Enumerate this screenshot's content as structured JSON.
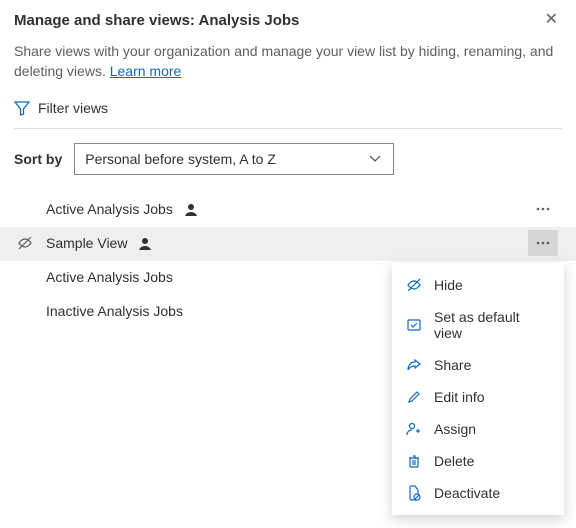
{
  "header": {
    "title": "Manage and share views: Analysis Jobs"
  },
  "description": {
    "text": "Share views with your organization and manage your view list by hiding, renaming, and deleting views. ",
    "link": "Learn more"
  },
  "filter": {
    "label": "Filter views"
  },
  "sort": {
    "label": "Sort by",
    "selected": "Personal before system, A to Z"
  },
  "views": [
    {
      "name": "Active Analysis Jobs",
      "personal": true,
      "hidden": false,
      "showMenu": true,
      "hover": false
    },
    {
      "name": "Sample View",
      "personal": true,
      "hidden": true,
      "showMenu": true,
      "hover": true
    },
    {
      "name": "Active Analysis Jobs",
      "personal": false,
      "hidden": false,
      "showMenu": false,
      "hover": false
    },
    {
      "name": "Inactive Analysis Jobs",
      "personal": false,
      "hidden": false,
      "showMenu": false,
      "hover": false
    }
  ],
  "menu": {
    "items": [
      {
        "icon": "hide-icon",
        "label": "Hide"
      },
      {
        "icon": "default-view-icon",
        "label": "Set as default view"
      },
      {
        "icon": "share-icon",
        "label": "Share"
      },
      {
        "icon": "edit-icon",
        "label": "Edit info"
      },
      {
        "icon": "assign-icon",
        "label": "Assign"
      },
      {
        "icon": "delete-icon",
        "label": "Delete"
      },
      {
        "icon": "deactivate-icon",
        "label": "Deactivate"
      }
    ]
  }
}
